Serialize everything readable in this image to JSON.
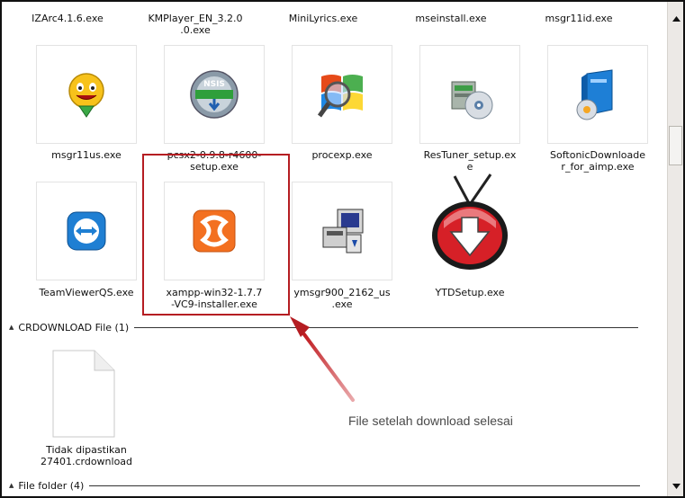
{
  "top_row": [
    {
      "id": "izarc",
      "label": "IZArc4.1.6.exe"
    },
    {
      "id": "kmplayer",
      "label": "KMPlayer_EN_3.2.0\n.0.exe"
    },
    {
      "id": "minilyrics",
      "label": "MiniLyrics.exe"
    },
    {
      "id": "mseinstall",
      "label": "mseinstall.exe"
    },
    {
      "id": "msgr11id",
      "label": "msgr11id.exe"
    }
  ],
  "row2": [
    {
      "id": "msgr11us",
      "label": "msgr11us.exe",
      "icon": "yahoo-messenger-icon"
    },
    {
      "id": "pcsx2",
      "label": "pcsx2-0.9.8-r4600-\nsetup.exe",
      "icon": "nsis-installer-icon",
      "badge": "NSIS"
    },
    {
      "id": "procexp",
      "label": "procexp.exe",
      "icon": "process-explorer-icon"
    },
    {
      "id": "restuner",
      "label": "ResTuner_setup.ex\ne",
      "icon": "restuner-icon"
    },
    {
      "id": "softonic",
      "label": "SoftonicDownloade\nr_for_aimp.exe",
      "icon": "softonic-box-icon"
    }
  ],
  "row3": [
    {
      "id": "teamviewer",
      "label": "TeamViewerQS.exe",
      "icon": "teamviewer-icon"
    },
    {
      "id": "xampp",
      "label": "xampp-win32-1.7.7\n-VC9-installer.exe",
      "icon": "xampp-icon"
    },
    {
      "id": "ymsgr",
      "label": "ymsgr900_2162_us\n.exe",
      "icon": "installer-computer-icon"
    },
    {
      "id": "ytdsetup",
      "label": "YTDSetup.exe",
      "icon": "ytd-tv-icon"
    }
  ],
  "groups": {
    "crdownload": "CRDOWNLOAD File (1)",
    "folder": "File folder (4)"
  },
  "crdownload_item": {
    "label": "Tidak dipastikan\n27401.crdownload",
    "icon": "blank-document-icon"
  },
  "annotation": "File setelah download selesai",
  "colors": {
    "callout": "#b51d22",
    "arrow": "#b51d22"
  }
}
